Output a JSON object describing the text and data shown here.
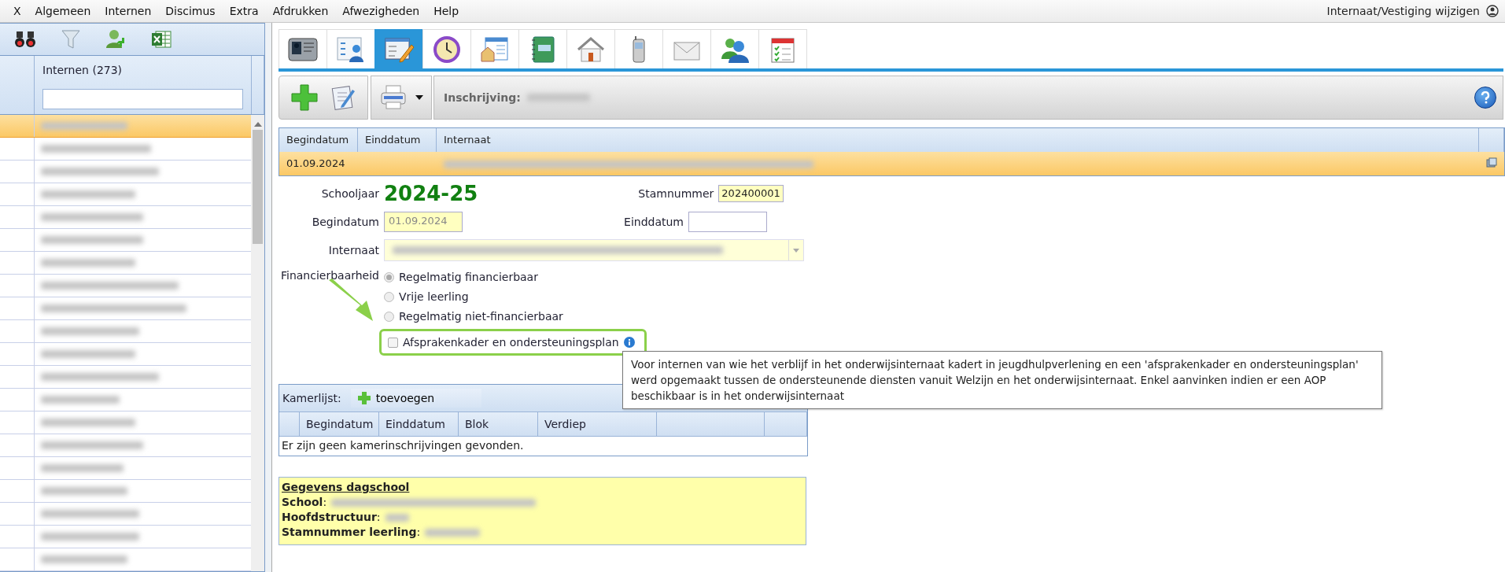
{
  "menu": {
    "items": [
      "X",
      "Algemeen",
      "Internen",
      "Discimus",
      "Extra",
      "Afdrukken",
      "Afwezigheden",
      "Help"
    ],
    "right_label": "Internaat/Vestiging wijzigen"
  },
  "left_panel": {
    "toolbar": [
      {
        "kind": "binoculars"
      },
      {
        "kind": "funnel"
      },
      {
        "kind": "person-add"
      },
      {
        "kind": "spreadsheet"
      }
    ],
    "list_header": "Internen (273)",
    "rows": [
      {
        "selected": true
      },
      {
        "selected": false
      },
      {
        "selected": false
      },
      {
        "selected": false
      },
      {
        "selected": false
      },
      {
        "selected": false
      },
      {
        "selected": false
      },
      {
        "selected": false
      },
      {
        "selected": false
      },
      {
        "selected": false
      },
      {
        "selected": false
      },
      {
        "selected": false
      },
      {
        "selected": false
      },
      {
        "selected": false
      },
      {
        "selected": false
      },
      {
        "selected": false
      },
      {
        "selected": false
      },
      {
        "selected": false
      },
      {
        "selected": false
      },
      {
        "selected": false
      }
    ]
  },
  "tabs": [
    {
      "kind": "id-card",
      "selected": false
    },
    {
      "kind": "checklist-person",
      "selected": false
    },
    {
      "kind": "form-pencil",
      "selected": true
    },
    {
      "kind": "clock",
      "selected": false
    },
    {
      "kind": "house-window",
      "selected": false
    },
    {
      "kind": "notebook",
      "selected": false
    },
    {
      "kind": "house",
      "selected": false
    },
    {
      "kind": "phone",
      "selected": false
    },
    {
      "kind": "envelope",
      "selected": false
    },
    {
      "kind": "people",
      "selected": false
    },
    {
      "kind": "calendar",
      "selected": false
    }
  ],
  "toolbar": {
    "label": "Inschrijving:"
  },
  "grid": {
    "columns": [
      "Begindatum",
      "Einddatum",
      "Internaat"
    ],
    "rows": [
      {
        "begindatum": "01.09.2024",
        "selected": true
      }
    ]
  },
  "form": {
    "schooljaar_label": "Schooljaar",
    "schooljaar": "2024-25",
    "stamnummer_label": "Stamnummer",
    "stamnummer": "202400001",
    "begindatum_label": "Begindatum",
    "begindatum": "01.09.2024",
    "einddatum_label": "Einddatum",
    "internaat_label": "Internaat",
    "financierbaarheid_label": "Financierbaarheid",
    "radios": [
      {
        "label": "Regelmatig financierbaar",
        "selected": true
      },
      {
        "label": "Vrije leerling",
        "selected": false
      },
      {
        "label": "Regelmatig niet-financierbaar",
        "selected": false
      }
    ],
    "checkbox": {
      "label": "Afsprakenkader en ondersteuningsplan",
      "checked": false,
      "highlighted": true
    }
  },
  "tooltip": "Voor internen van wie het verblijf in het onderwijsinternaat kadert in jeugdhulpverlening en een 'afsprakenkader en ondersteuningsplan' werd opgemaakt tussen de ondersteunende diensten vanuit Welzijn en het onderwijsinternaat. Enkel aanvinken indien er een AOP beschikbaar is in het onderwijsinternaat",
  "kamerlijst": {
    "title": "Kamerlijst:",
    "add_button": "toevoegen",
    "columns": [
      "Begindatum",
      "Einddatum",
      "Blok",
      "Verdiep"
    ],
    "empty_message": "Er zijn geen kamerinschrijvingen gevonden."
  },
  "dagschool": {
    "title": "Gegevens dagschool",
    "fields": [
      "**School**:",
      "**Hoofdstructuur**:",
      "**Stamnummer leerling**:"
    ]
  }
}
